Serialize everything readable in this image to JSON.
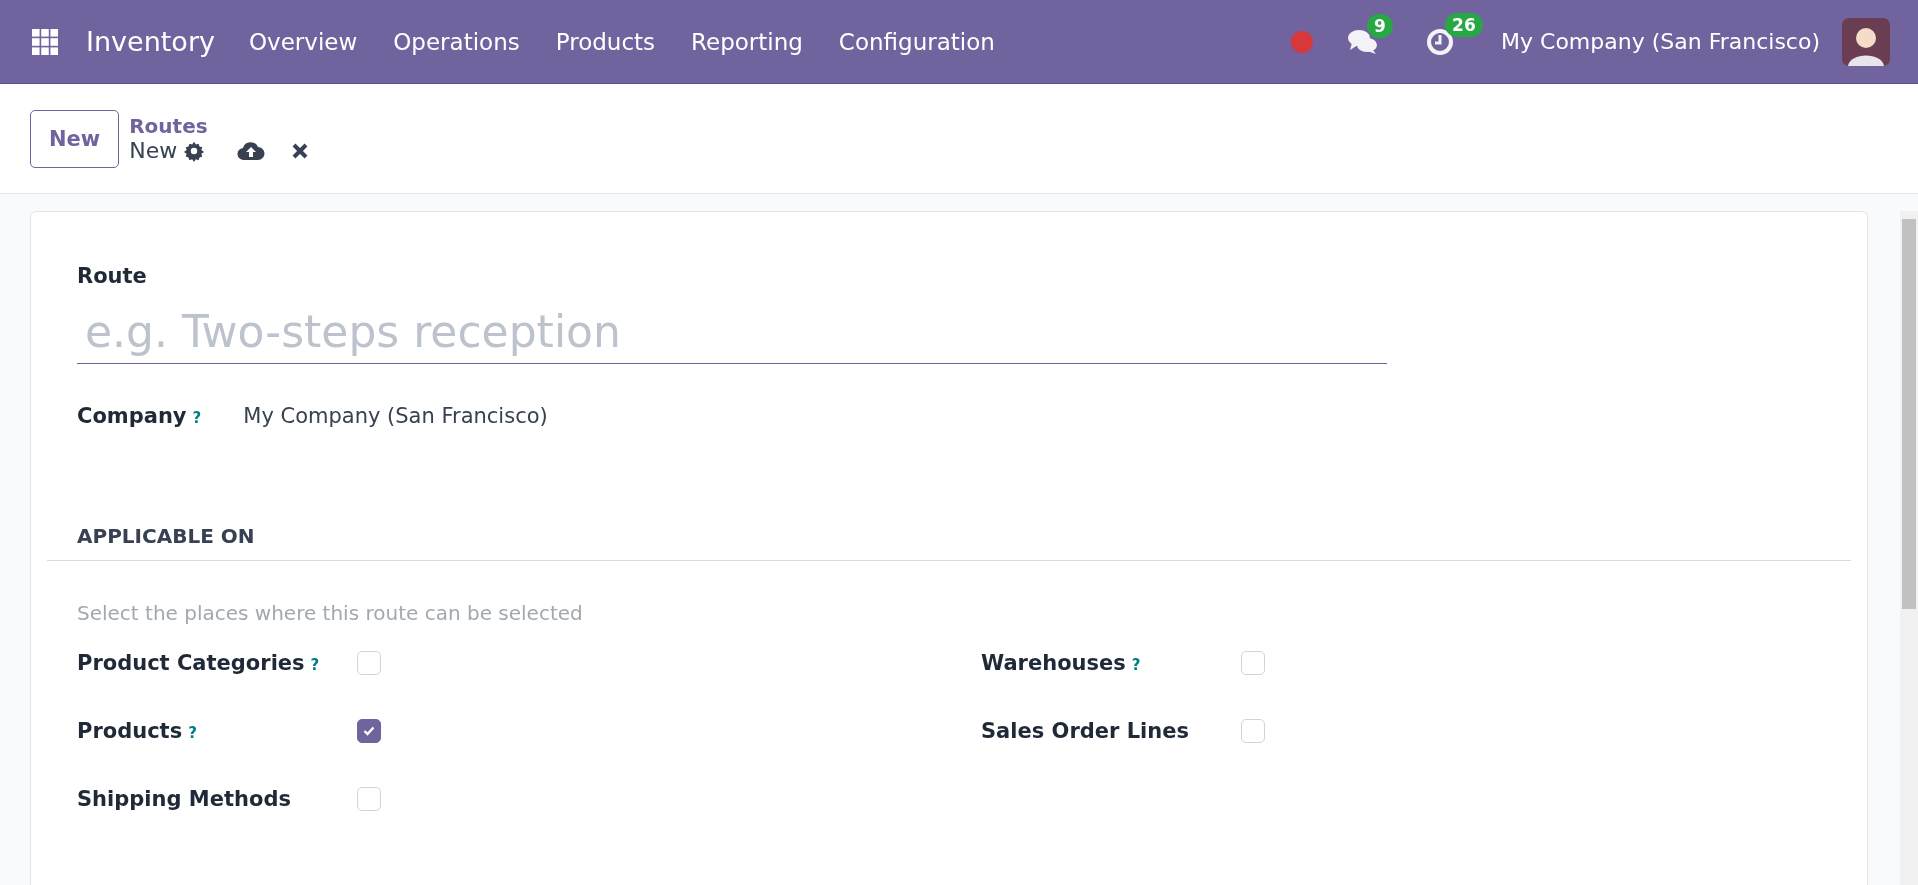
{
  "navbar": {
    "app_name": "Inventory",
    "menu": [
      {
        "label": "Overview"
      },
      {
        "label": "Operations"
      },
      {
        "label": "Products"
      },
      {
        "label": "Reporting"
      },
      {
        "label": "Configuration"
      }
    ],
    "messages_count": "9",
    "activities_count": "26",
    "company": "My Company (San Francisco)"
  },
  "control_panel": {
    "new_button": "New",
    "breadcrumb": "Routes",
    "record": "New"
  },
  "form": {
    "route_label": "Route",
    "route_placeholder": "e.g. Two-steps reception",
    "company": {
      "label": "Company",
      "help": "?",
      "value": "My Company (San Francisco)"
    },
    "section_title": "APPLICABLE ON",
    "section_hint": "Select the places where this route can be selected",
    "left_options": [
      {
        "label": "Product Categories",
        "help": "?",
        "checked": false
      },
      {
        "label": "Products",
        "help": "?",
        "checked": true
      },
      {
        "label": "Shipping Methods",
        "checked": false
      }
    ],
    "right_options": [
      {
        "label": "Warehouses",
        "help": "?",
        "checked": false
      },
      {
        "label": "Sales Order Lines",
        "checked": false
      }
    ]
  }
}
